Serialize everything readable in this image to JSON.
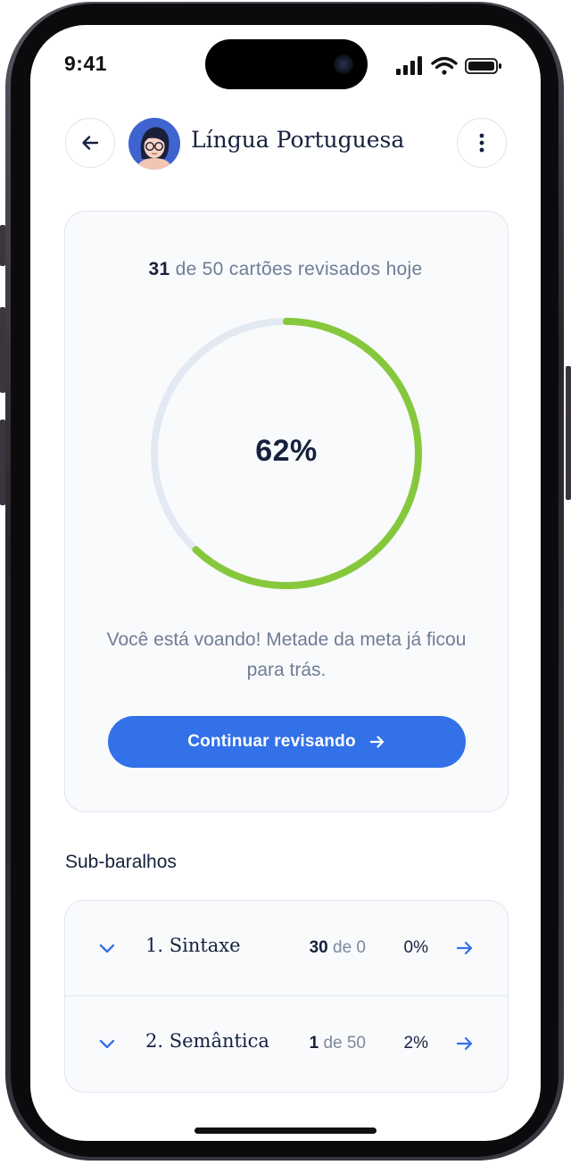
{
  "status_bar": {
    "time": "9:41"
  },
  "header": {
    "title": "Língua Portuguesa",
    "back_icon": "arrow-left-icon",
    "menu_icon": "more-vertical-icon"
  },
  "progress": {
    "reviewed": "31",
    "summary_rest": " de 50 cartões revisados hoje",
    "percent_label": "62%",
    "fraction": 0.62,
    "message": "Você está voando! Metade da meta já ficou para trás.",
    "button_label": "Continuar revisando"
  },
  "subdecks": {
    "title": "Sub-baralhos",
    "items": [
      {
        "name": "1. Sintaxe",
        "done": "30",
        "of": " de 0",
        "percent": "0%"
      },
      {
        "name": "2. Semântica",
        "done": "1",
        "of": " de 50",
        "percent": "2%"
      }
    ]
  },
  "colors": {
    "accent": "#3271e8",
    "progress": "#86c83c",
    "track": "#e3e9f2",
    "text_dark": "#16213e",
    "text_muted": "#6f7d95"
  }
}
